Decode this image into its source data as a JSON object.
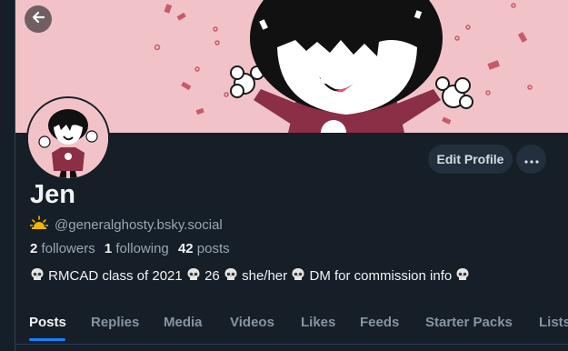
{
  "profile": {
    "display_name": "Jen",
    "handle": "@generalghosty.bsky.social",
    "followers_count": "2",
    "followers_label": "followers",
    "following_count": "1",
    "following_label": "following",
    "posts_count": "42",
    "posts_label": "posts",
    "bio": {
      "school": "RMCAD class of 2021",
      "age": "26",
      "pronouns": "she/her",
      "dm": "DM for commission info"
    }
  },
  "actions": {
    "edit_profile": "Edit Profile",
    "more": "···"
  },
  "tabs": [
    {
      "label": "Posts"
    },
    {
      "label": "Replies"
    },
    {
      "label": "Media"
    },
    {
      "label": "Videos"
    },
    {
      "label": "Likes"
    },
    {
      "label": "Feeds"
    },
    {
      "label": "Starter Packs"
    },
    {
      "label": "Lists"
    }
  ],
  "colors": {
    "background": "#161e27",
    "banner": "#f1c3c8",
    "accent": "#1083fe",
    "muted_text": "#9aa6b2",
    "button_bg": "#232f3c"
  },
  "icons": [
    "back-arrow-icon",
    "sun-icon",
    "skull-icon",
    "more-icon"
  ]
}
